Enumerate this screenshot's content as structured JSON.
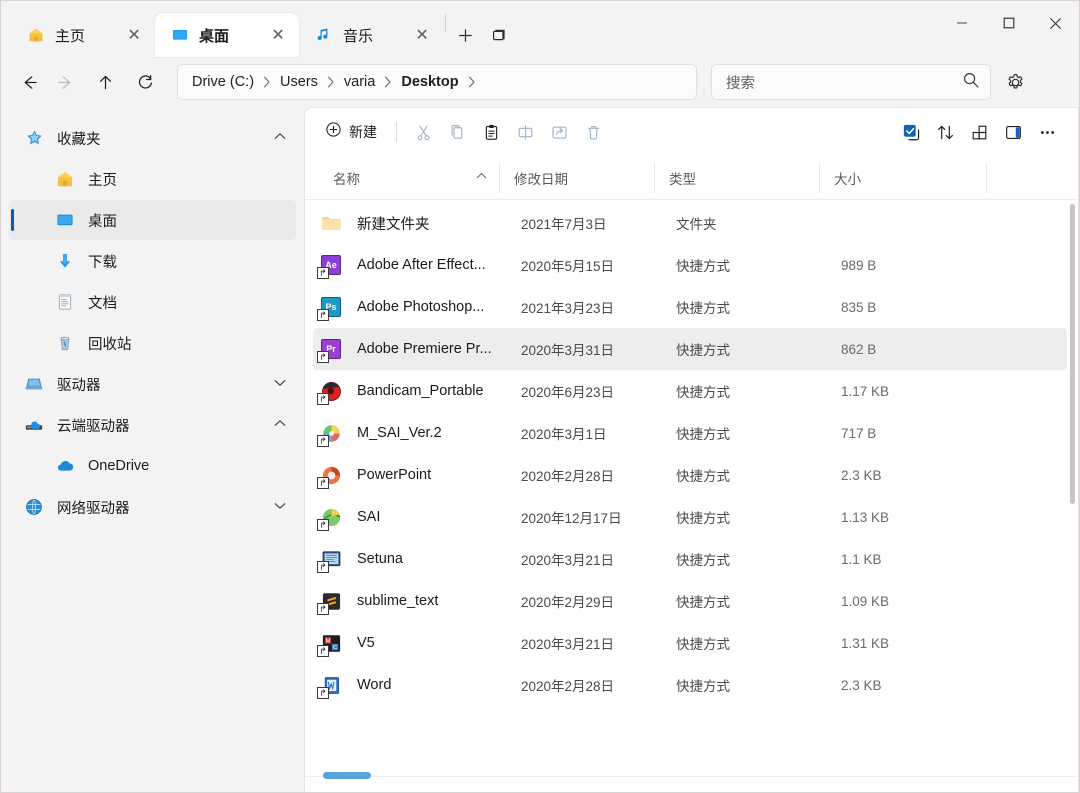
{
  "window": {
    "controls": {
      "minimize": "—",
      "maximize": "□",
      "close": "✕"
    }
  },
  "tabs": {
    "items": [
      {
        "label": "主页",
        "icon": "home-icon",
        "active": false,
        "close": "✕"
      },
      {
        "label": "桌面",
        "icon": "desktop-icon",
        "active": true,
        "close": "✕"
      },
      {
        "label": "音乐",
        "icon": "music-note-icon",
        "active": false,
        "close": "✕"
      }
    ],
    "new_tab": "+",
    "tab_list": "⧉"
  },
  "nav": {
    "back": "←",
    "forward": "→",
    "up": "↑",
    "refresh": "↻",
    "breadcrumb": [
      {
        "label": "Drive (C:)",
        "current": false
      },
      {
        "label": "Users",
        "current": false
      },
      {
        "label": "varia",
        "current": false
      },
      {
        "label": "Desktop",
        "current": true
      }
    ],
    "crumb_separator": "›"
  },
  "search": {
    "placeholder": "搜索",
    "icon": "search-icon"
  },
  "settings": {
    "icon": "gear-icon"
  },
  "toolbar": {
    "new_label": "新建",
    "new_icon": "plus-circle-icon",
    "buttons": [
      {
        "name": "cut-button",
        "icon": "scissors-icon"
      },
      {
        "name": "copy-button",
        "icon": "copy-icon"
      },
      {
        "name": "paste-button",
        "icon": "clipboard-icon"
      },
      {
        "name": "rename-button",
        "icon": "rename-icon"
      },
      {
        "name": "share-button",
        "icon": "share-icon"
      },
      {
        "name": "delete-button",
        "icon": "trash-icon"
      }
    ],
    "right_buttons": [
      {
        "name": "select-button",
        "icon": "checkbox-select-icon"
      },
      {
        "name": "sort-button",
        "icon": "sort-arrows-icon"
      },
      {
        "name": "view-button",
        "icon": "layout-grid-icon"
      },
      {
        "name": "details-pane-button",
        "icon": "details-pane-icon"
      },
      {
        "name": "more-button",
        "icon": "ellipsis-icon"
      }
    ]
  },
  "sidebar": {
    "items": [
      {
        "label": "收藏夹",
        "icon": "star-pin-icon",
        "level": 0,
        "chevron": "⌃",
        "selected": false
      },
      {
        "label": "主页",
        "icon": "home-icon",
        "level": 1,
        "chevron": "",
        "selected": false
      },
      {
        "label": "桌面",
        "icon": "desktop-icon",
        "level": 1,
        "chevron": "",
        "selected": true
      },
      {
        "label": "下载",
        "icon": "download-icon",
        "level": 1,
        "chevron": "",
        "selected": false
      },
      {
        "label": "文档",
        "icon": "document-icon",
        "level": 1,
        "chevron": "",
        "selected": false
      },
      {
        "label": "回收站",
        "icon": "recycle-bin-icon",
        "level": 1,
        "chevron": "",
        "selected": false
      },
      {
        "label": "驱动器",
        "icon": "drive-icon",
        "level": 0,
        "chevron": "⌄",
        "selected": false
      },
      {
        "label": "云端驱动器",
        "icon": "cloud-drive-icon",
        "level": 0,
        "chevron": "⌃",
        "selected": false
      },
      {
        "label": "OneDrive",
        "icon": "onedrive-cloud-icon",
        "level": 1,
        "chevron": "",
        "selected": false
      },
      {
        "label": "网络驱动器",
        "icon": "network-drive-icon",
        "level": 0,
        "chevron": "⌄",
        "selected": false
      }
    ]
  },
  "filelist": {
    "columns": [
      {
        "label": "名称",
        "sort": "⌃"
      },
      {
        "label": "修改日期",
        "sort": ""
      },
      {
        "label": "类型",
        "sort": ""
      },
      {
        "label": "大小",
        "sort": ""
      }
    ],
    "rows": [
      {
        "name": "新建文件夹",
        "date": "2021年7月3日",
        "type": "文件夹",
        "size": "",
        "icon": "folder-icon",
        "selected": false
      },
      {
        "name": "Adobe After Effect...",
        "date": "2020年5月15日",
        "type": "快捷方式",
        "size": "989 B",
        "icon": "after-effects-icon",
        "selected": false
      },
      {
        "name": "Adobe Photoshop...",
        "date": "2021年3月23日",
        "type": "快捷方式",
        "size": "835 B",
        "icon": "photoshop-icon",
        "selected": false
      },
      {
        "name": "Adobe Premiere Pr...",
        "date": "2020年3月31日",
        "type": "快捷方式",
        "size": "862 B",
        "icon": "premiere-icon",
        "selected": true
      },
      {
        "name": "Bandicam_Portable",
        "date": "2020年6月23日",
        "type": "快捷方式",
        "size": "1.17 KB",
        "icon": "bandicam-icon",
        "selected": false
      },
      {
        "name": "M_SAI_Ver.2",
        "date": "2020年3月1日",
        "type": "快捷方式",
        "size": "717 B",
        "icon": "sai2-icon",
        "selected": false
      },
      {
        "name": "PowerPoint",
        "date": "2020年2月28日",
        "type": "快捷方式",
        "size": "2.3 KB",
        "icon": "powerpoint-icon",
        "selected": false
      },
      {
        "name": "SAI",
        "date": "2020年12月17日",
        "type": "快捷方式",
        "size": "1.13 KB",
        "icon": "sai-icon",
        "selected": false
      },
      {
        "name": "Setuna",
        "date": "2020年3月21日",
        "type": "快捷方式",
        "size": "1.1 KB",
        "icon": "setuna-icon",
        "selected": false
      },
      {
        "name": "sublime_text",
        "date": "2020年2月29日",
        "type": "快捷方式",
        "size": "1.09 KB",
        "icon": "sublime-icon",
        "selected": false
      },
      {
        "name": "V5",
        "date": "2020年3月21日",
        "type": "快捷方式",
        "size": "1.31 KB",
        "icon": "v5-icon",
        "selected": false
      },
      {
        "name": "Word",
        "date": "2020年2月28日",
        "type": "快捷方式",
        "size": "2.3 KB",
        "icon": "word-icon",
        "selected": false
      }
    ]
  },
  "colors": {
    "accent": "#0b5bb5",
    "selection": "#ededed",
    "window_bg": "#f3f3f3",
    "pane_bg": "#ffffff",
    "scroll_thumb": "#5ba3dc"
  }
}
